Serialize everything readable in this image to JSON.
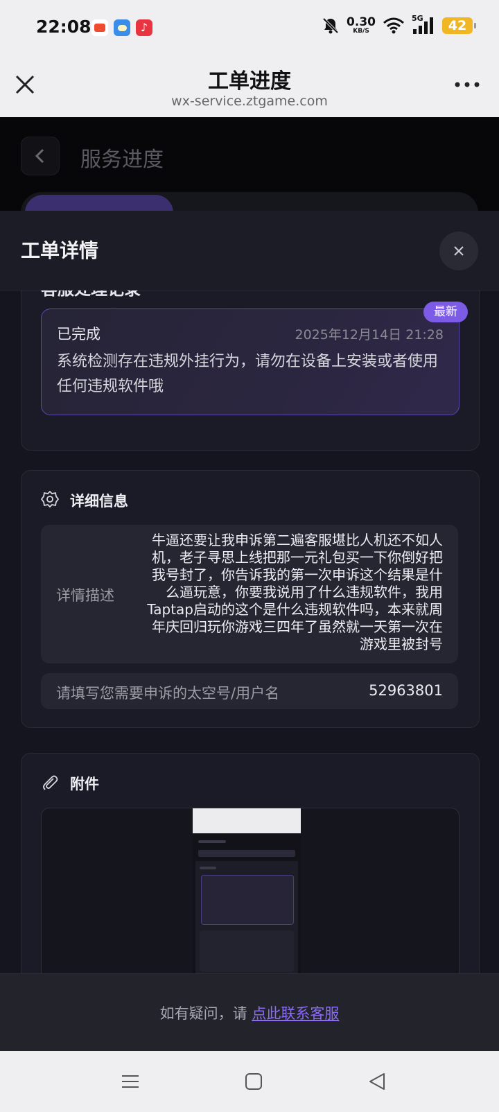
{
  "status_bar": {
    "time": "22:08",
    "speed_value": "0.30",
    "speed_unit": "KB/S",
    "network": "5G",
    "battery": "42"
  },
  "browser": {
    "title": "工单进度",
    "domain": "wx-service.ztgame.com"
  },
  "background_page": {
    "title": "服务进度"
  },
  "modal": {
    "title": "工单详情",
    "record_section": {
      "heading": "客服处理记录",
      "badge": "最新",
      "status": "已完成",
      "time": "2025年12月14日 21:28",
      "content": "系统检测存在违规外挂行为，请勿在设备上安装或者使用任何违规软件哦"
    },
    "detail_section": {
      "title": "详细信息",
      "desc_label": "详情描述",
      "desc_value": "牛逼还要让我申诉第二遍客服堪比人机还不如人机，老子寻思上线把那一元礼包买一下你倒好把我号封了，你告诉我的第一次申诉这个结果是什么逼玩意，你要我说用了什么违规软件，我用Taptap启动的这个是什么违规软件吗，本来就周年庆回归玩你游戏三四年了虽然就一天第一次在游戏里被封号",
      "account_label": "请填写您需要申诉的太空号/用户名",
      "account_value": "52963801"
    },
    "attachment_section": {
      "title": "附件"
    }
  },
  "footer": {
    "prefix": "如有疑问，请 ",
    "link": "点此联系客服"
  },
  "colors": {
    "accent": "#7c5ce6",
    "link": "#8c6cf5",
    "battery": "#f1b623"
  },
  "icons": [
    "close-icon",
    "more-icon",
    "back-chevron-icon",
    "gear-icon",
    "paperclip-icon",
    "menu-icon",
    "home-icon",
    "back-icon"
  ]
}
